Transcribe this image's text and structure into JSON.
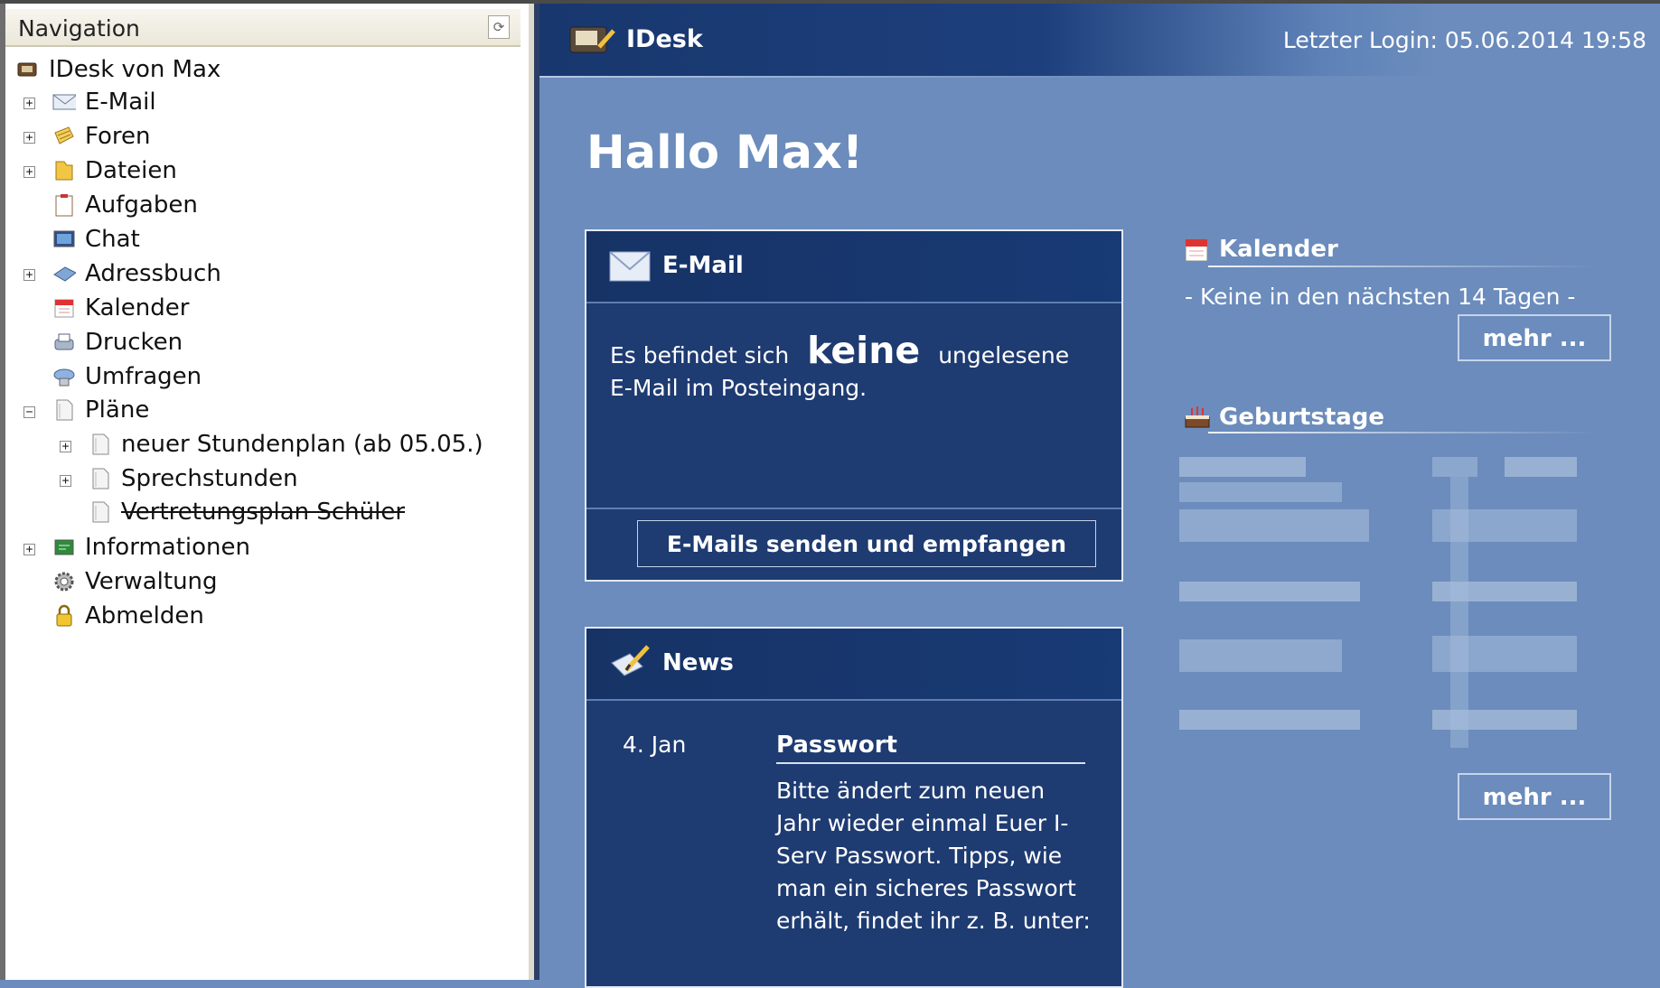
{
  "nav": {
    "title": "Navigation",
    "items": [
      {
        "label": "IDesk von Max",
        "icon": "idesk-icon"
      },
      {
        "label": "E-Mail",
        "icon": "envelope-icon",
        "expander": "+"
      },
      {
        "label": "Foren",
        "icon": "forum-icon",
        "expander": "+"
      },
      {
        "label": "Dateien",
        "icon": "folder-icon",
        "expander": "+"
      },
      {
        "label": "Aufgaben",
        "icon": "clipboard-icon"
      },
      {
        "label": "Chat",
        "icon": "chat-icon"
      },
      {
        "label": "Adressbuch",
        "icon": "addressbook-icon",
        "expander": "+"
      },
      {
        "label": "Kalender",
        "icon": "calendar-icon"
      },
      {
        "label": "Drucken",
        "icon": "printer-icon"
      },
      {
        "label": "Umfragen",
        "icon": "poll-icon"
      },
      {
        "label": "Pläne",
        "icon": "document-icon",
        "expander": "−"
      },
      {
        "label": "neuer Stundenplan (ab 05.05.)",
        "icon": "document-icon",
        "expander": "+"
      },
      {
        "label": "Sprechstunden",
        "icon": "document-icon",
        "expander": "+"
      },
      {
        "label": "Vertretungsplan Schüler",
        "icon": "document-icon"
      },
      {
        "label": "Informationen",
        "icon": "info-board-icon",
        "expander": "+"
      },
      {
        "label": "Verwaltung",
        "icon": "gear-icon"
      },
      {
        "label": "Abmelden",
        "icon": "lock-icon"
      }
    ]
  },
  "header": {
    "app_title": "IDesk",
    "last_login": "Letzter Login: 05.06.2014 19:58"
  },
  "greeting": "Hallo Max!",
  "email_panel": {
    "title": "E-Mail",
    "text_before": "Es befindet sich",
    "count_word": "keine",
    "text_after": "ungelesene",
    "text_line2": "E-Mail im Posteingang.",
    "button_label": "E-Mails senden und empfangen"
  },
  "news_panel": {
    "title": "News",
    "date": "4. Jan",
    "headline": "Passwort",
    "body": "Bitte ändert zum neuen Jahr wieder einmal Euer I-Serv Passwort. Tipps, wie man ein sicheres Passwort erhält, findet ihr z. B. unter:"
  },
  "calendar": {
    "title": "Kalender",
    "empty_text": "- Keine in den nächsten 14 Tagen -",
    "more_label": "mehr ..."
  },
  "birthdays": {
    "title": "Geburtstage",
    "more_label": "mehr ..."
  },
  "colors": {
    "background": "#6b8cbc",
    "panel": "#1e3b72",
    "header_dark": "#18376e"
  }
}
